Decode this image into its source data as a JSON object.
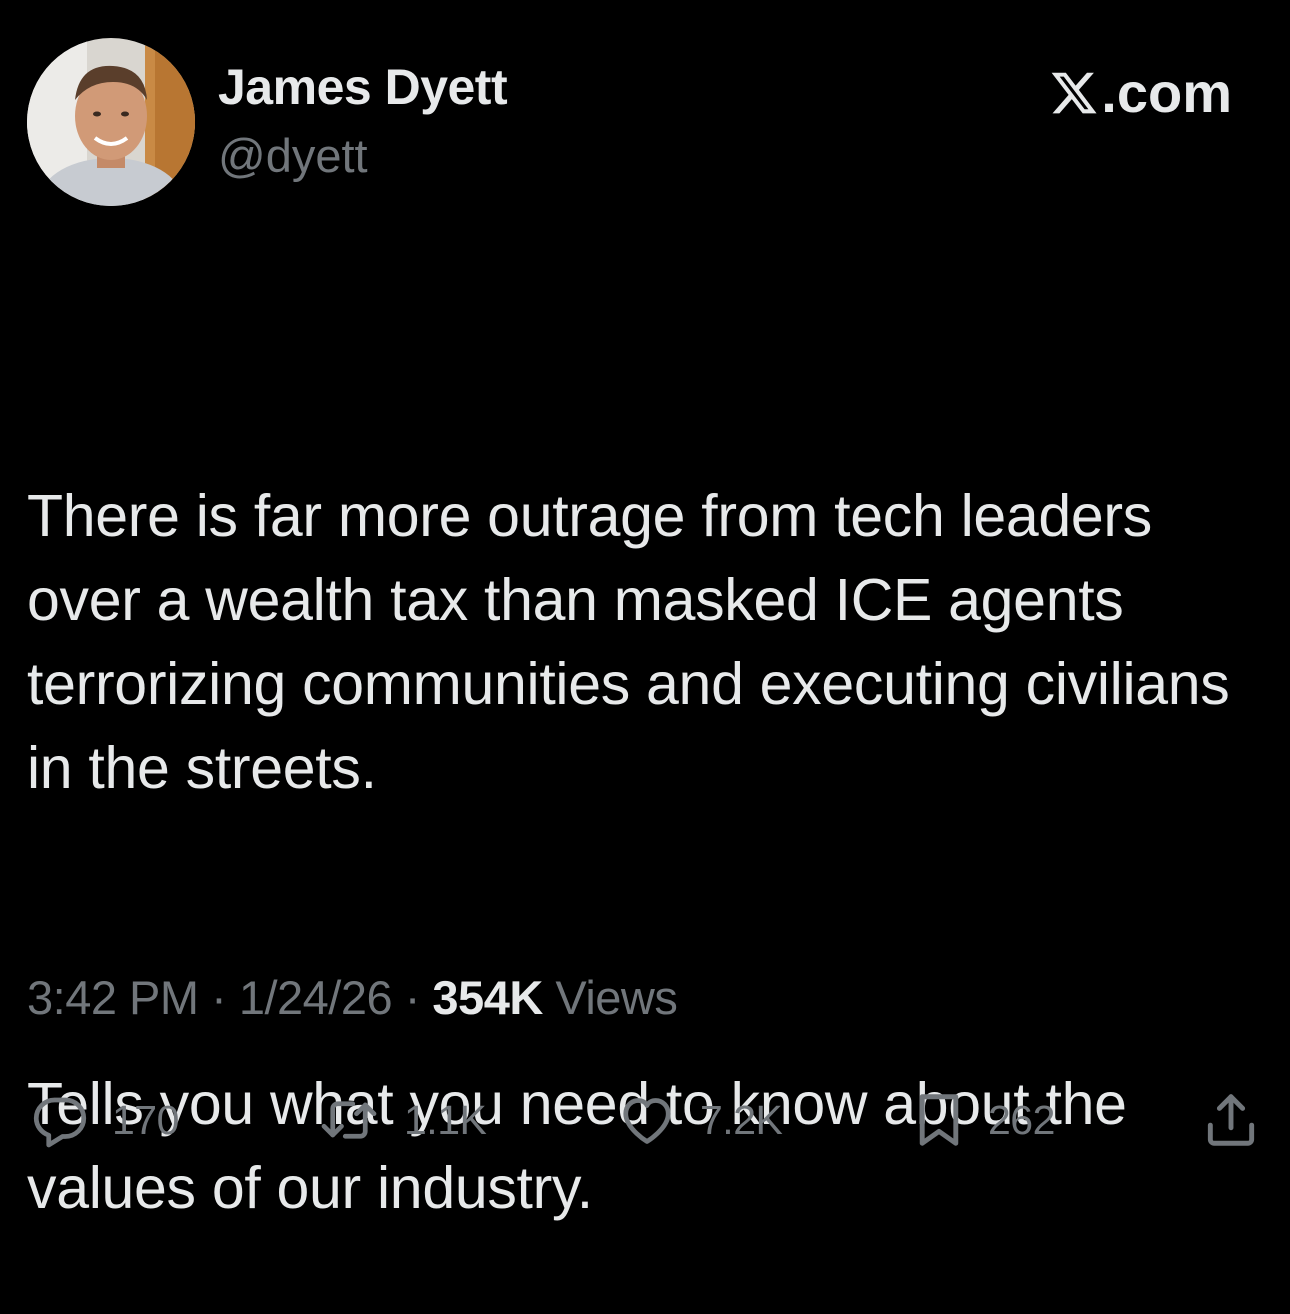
{
  "author": {
    "display_name": "James Dyett",
    "handle": "@dyett"
  },
  "brand": {
    "label": ".com",
    "logo": "x-logo-icon"
  },
  "tweet": {
    "paragraphs": [
      "There is far more outrage from tech leaders over a wealth tax than masked ICE agents terrorizing communities and executing civilians in the streets.",
      "Tells you what you need to know about the values of our industry."
    ]
  },
  "meta": {
    "time": "3:42 PM",
    "separator": "·",
    "date": "1/24/26",
    "views_count": "354K",
    "views_label": "Views"
  },
  "actions": {
    "replies": {
      "icon": "reply-icon",
      "count": "170"
    },
    "reposts": {
      "icon": "repost-icon",
      "count": "1.1K"
    },
    "likes": {
      "icon": "heart-icon",
      "count": "7.2K"
    },
    "bookmarks": {
      "icon": "bookmark-icon",
      "count": "262"
    },
    "share": {
      "icon": "share-icon"
    }
  },
  "colors": {
    "background": "#000000",
    "primary_text": "#e7e9ea",
    "secondary_text": "#71767b"
  }
}
